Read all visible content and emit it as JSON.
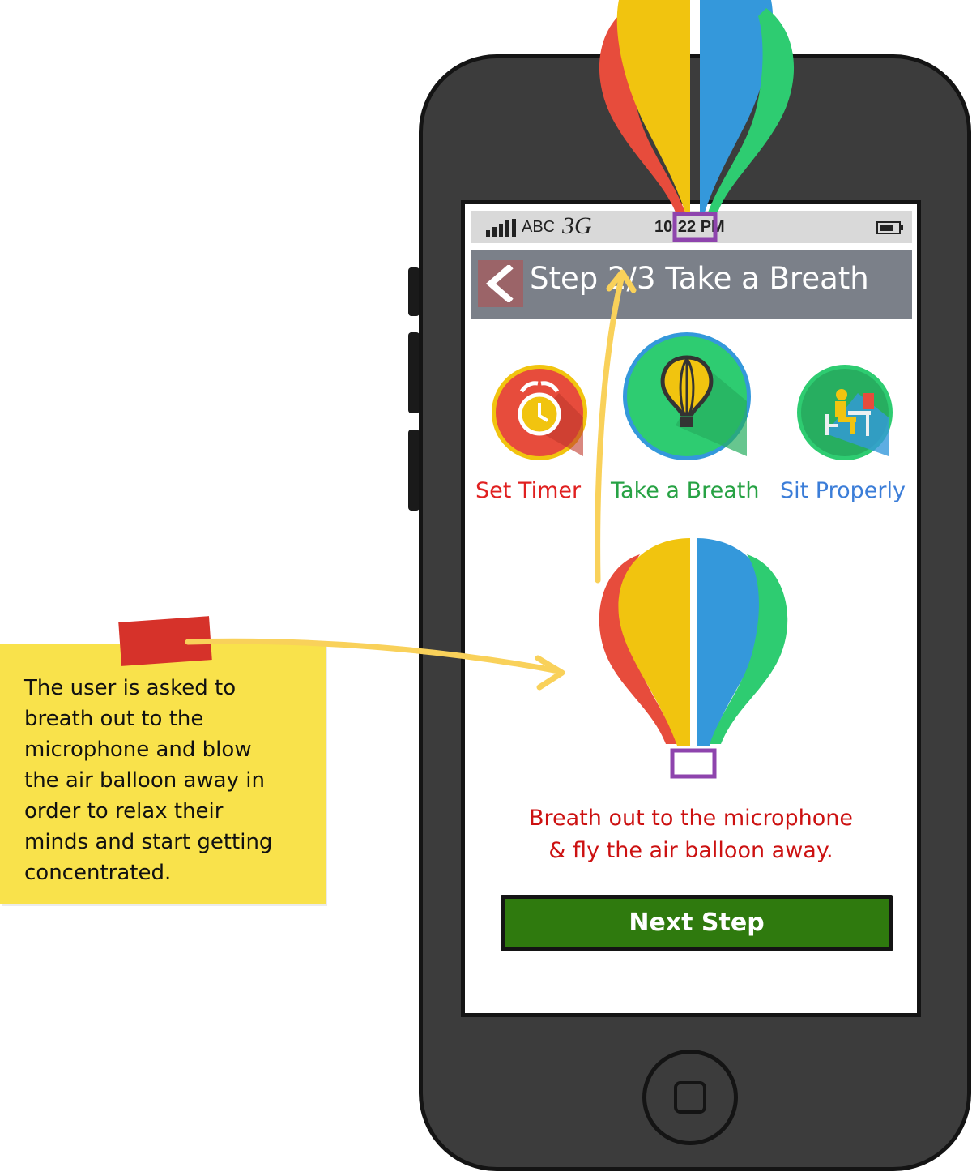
{
  "status_bar": {
    "carrier": "ABC",
    "network": "3G",
    "time": "10:22 PM",
    "signal_icon": "signal-bars-icon",
    "battery_icon": "battery-icon"
  },
  "nav": {
    "title": "Step 2/3 Take a Breath",
    "back_icon": "chevron-left-icon"
  },
  "steps": [
    {
      "label": "Set Timer",
      "icon": "alarm-clock-icon",
      "color": "#e02020"
    },
    {
      "label": "Take a Breath",
      "icon": "air-balloon-icon",
      "color": "#27a244"
    },
    {
      "label": "Sit Properly",
      "icon": "person-at-desk-icon",
      "color": "#3b7dd8"
    }
  ],
  "instruction": {
    "line1": "Breath out to the microphone",
    "line2": "& fly the air balloon away."
  },
  "next_step_label": "Next Step",
  "note": {
    "lines": [
      "The user is asked to",
      "breath out to the",
      "microphone and blow",
      "the air balloon away in",
      "order to relax their",
      "minds and start getting",
      "concentrated."
    ]
  },
  "colors": {
    "balloon_red": "#e74c3c",
    "balloon_yellow": "#f1c40f",
    "balloon_blue": "#3498db",
    "balloon_green": "#2ecc71",
    "annotation_arrow": "#f9d15a",
    "basket_outline": "#8e44ad",
    "next_button": "#2f7a0e"
  }
}
